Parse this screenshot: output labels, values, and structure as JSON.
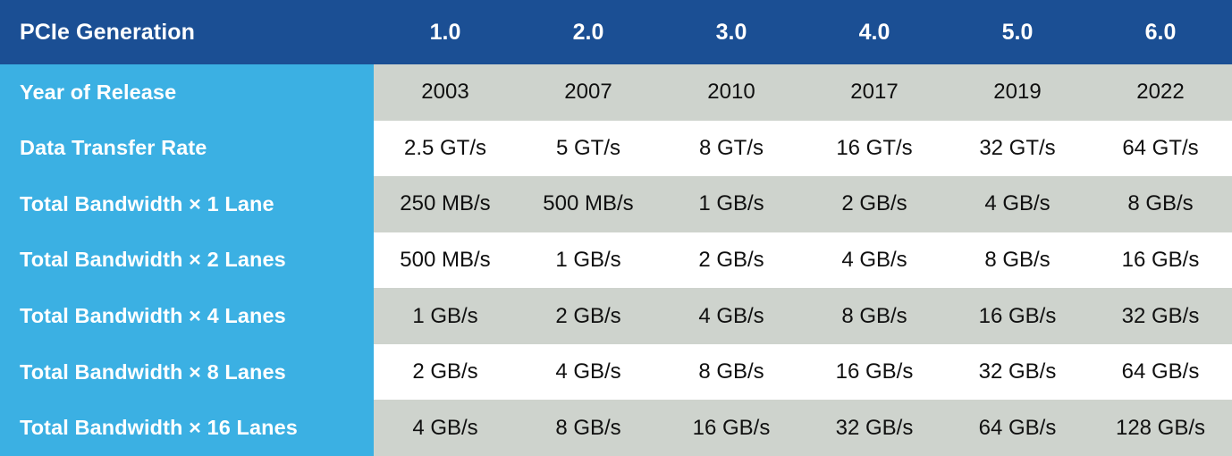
{
  "table": {
    "header": {
      "row_label": "PCIe Generation",
      "columns": [
        "1.0",
        "2.0",
        "3.0",
        "4.0",
        "5.0",
        "6.0"
      ]
    },
    "rows": [
      {
        "label": "Year of Release",
        "band": "gray",
        "values": [
          "2003",
          "2007",
          "2010",
          "2017",
          "2019",
          "2022"
        ]
      },
      {
        "label": "Data Transfer Rate",
        "band": "white",
        "values": [
          "2.5 GT/s",
          "5 GT/s",
          "8 GT/s",
          "16 GT/s",
          "32 GT/s",
          "64 GT/s"
        ]
      },
      {
        "label": "Total Bandwidth × 1 Lane",
        "band": "gray",
        "values": [
          "250 MB/s",
          "500 MB/s",
          "1 GB/s",
          "2 GB/s",
          "4 GB/s",
          "8 GB/s"
        ]
      },
      {
        "label": "Total Bandwidth × 2 Lanes",
        "band": "white",
        "values": [
          "500 MB/s",
          "1 GB/s",
          "2 GB/s",
          "4 GB/s",
          "8 GB/s",
          "16 GB/s"
        ]
      },
      {
        "label": "Total Bandwidth × 4 Lanes",
        "band": "gray",
        "values": [
          "1 GB/s",
          "2 GB/s",
          "4 GB/s",
          "8 GB/s",
          "16 GB/s",
          "32 GB/s"
        ]
      },
      {
        "label": "Total Bandwidth × 8 Lanes",
        "band": "white",
        "values": [
          "2 GB/s",
          "4 GB/s",
          "8 GB/s",
          "16 GB/s",
          "32 GB/s",
          "64 GB/s"
        ]
      },
      {
        "label": "Total Bandwidth × 16 Lanes",
        "band": "gray",
        "values": [
          "4 GB/s",
          "8 GB/s",
          "16 GB/s",
          "32 GB/s",
          "64 GB/s",
          "128 GB/s"
        ]
      }
    ],
    "colors": {
      "header_background": "#1b4f94",
      "label_background": "#3bb0e3",
      "band_gray": "#ced3cd",
      "band_white": "#ffffff",
      "header_text": "#ffffff",
      "label_text": "#ffffff",
      "cell_text": "#101010"
    }
  }
}
